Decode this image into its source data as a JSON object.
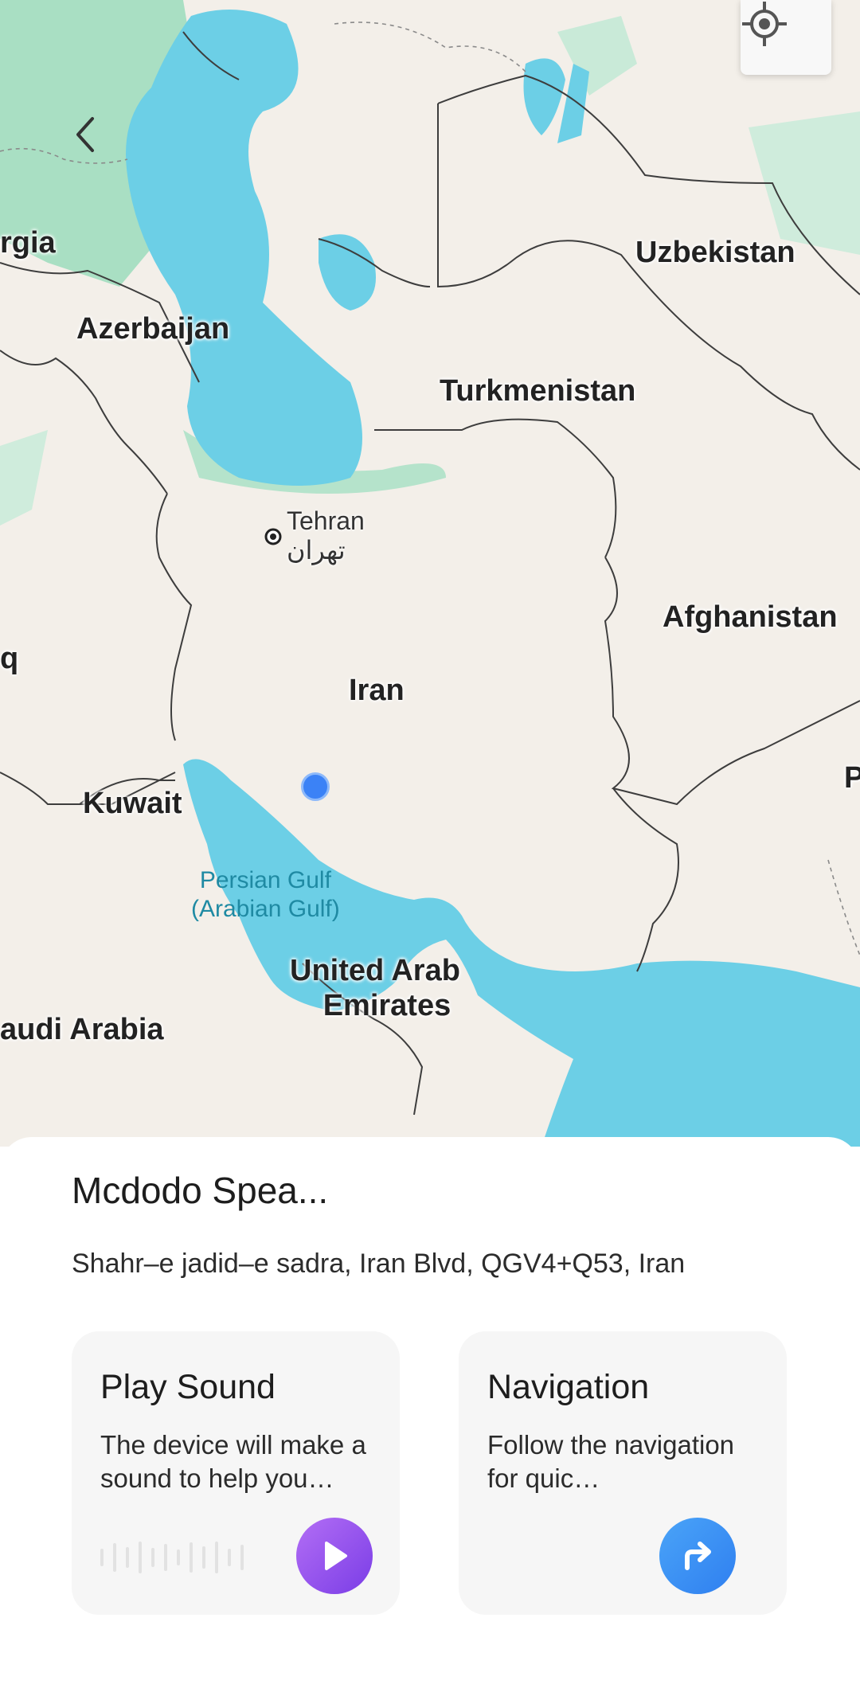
{
  "map": {
    "labels": {
      "georgia": "rgia",
      "azerbaijan": "Azerbaijan",
      "uzbekistan": "Uzbekistan",
      "turkmenistan": "Turkmenistan",
      "afghanistan": "Afghanistan",
      "iran": "Iran",
      "kuwait": "Kuwait",
      "uae_line1": "United Arab",
      "uae_line2": "Emirates",
      "saudi": "audi Arabia",
      "pakistan_partial": "P",
      "iraq_partial": "q"
    },
    "sea": {
      "line1": "Persian Gulf",
      "line2": "(Arabian Gulf)"
    },
    "city": {
      "name": "Tehran",
      "name_local": "تهران"
    },
    "colors": {
      "water": "#6ccfe6",
      "land": "#f3efe9",
      "vegetation": "#a9dfc3",
      "device_dot": "#3b82f6"
    },
    "icons": {
      "back": "chevron-left-icon",
      "locate": "crosshair-icon"
    }
  },
  "sheet": {
    "device_name": "Mcdodo Spea...",
    "address": "Shahr–e jadid–e sadra, Iran Blvd, QGV4+Q53, Iran",
    "cards": {
      "sound": {
        "title": "Play Sound",
        "description": "The device will make a sound to help you…",
        "icon": "play-icon",
        "color": "#8b4cec"
      },
      "navigation": {
        "title": "Navigation",
        "description": "Follow the navigation for quic…",
        "icon": "turn-right-arrow-icon",
        "color": "#3a8ff5"
      }
    }
  }
}
